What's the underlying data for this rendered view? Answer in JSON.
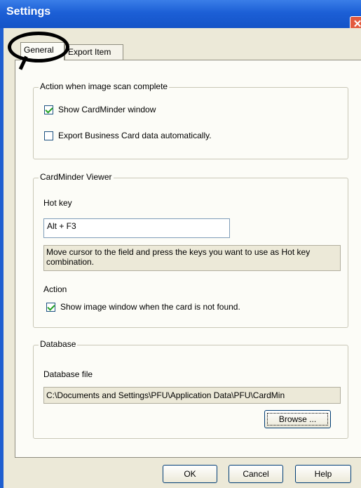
{
  "window": {
    "title": "Settings",
    "close_glyph": "✕"
  },
  "tabs": [
    {
      "label": "General",
      "active": true
    },
    {
      "label": "Export Item",
      "active": false
    }
  ],
  "scan_group": {
    "legend": "Action when image scan complete",
    "show_window": {
      "label": "Show CardMinder window",
      "checked": true
    },
    "export_auto": {
      "label": "Export Business Card data automatically.",
      "checked": false
    }
  },
  "viewer_group": {
    "legend": "CardMinder Viewer",
    "hotkey_label": "Hot key",
    "hotkey_value": "Alt + F3",
    "hint": "Move cursor to the field and press the keys you want to use as Hot key combination.",
    "action_label": "Action",
    "show_image": {
      "label": "Show image window when the card is not found.",
      "checked": true
    }
  },
  "database_group": {
    "legend": "Database",
    "file_label": "Database file",
    "file_path": "C:\\Documents and Settings\\PFU\\Application Data\\PFU\\CardMin",
    "browse_label": "Browse ..."
  },
  "footer": {
    "ok_label": "OK",
    "cancel_label": "Cancel",
    "help_label": "Help"
  },
  "colors": {
    "titlebar": "#1c5fd6",
    "dialog_bg": "#ece9d8",
    "panel_bg": "#fcfcf7",
    "checkmark": "#21a121",
    "close": "#e35a3e"
  }
}
